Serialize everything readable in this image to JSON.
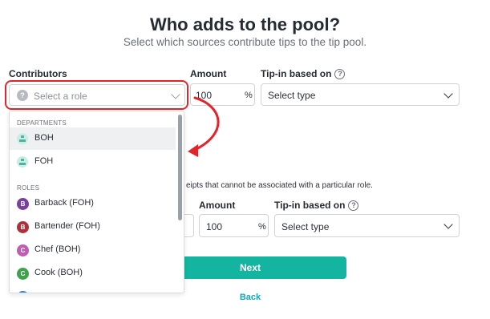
{
  "header": {
    "title": "Who adds to the pool?",
    "subtitle": "Select which sources contribute tips to the tip pool."
  },
  "row1": {
    "contributors_label": "Contributors",
    "amount_label": "Amount",
    "tipin_label": "Tip-in based on",
    "role_placeholder": "Select a role",
    "amount_value": "100",
    "percent_symbol": "%",
    "type_placeholder": "Select type"
  },
  "dropdown": {
    "departments_header": "DEPARTMENTS",
    "departments": [
      {
        "label": "BOH"
      },
      {
        "label": "FOH"
      }
    ],
    "roles_header": "ROLES",
    "roles": [
      {
        "label": "Barback (FOH)",
        "initial": "B",
        "color": "#7b3f9e"
      },
      {
        "label": "Bartender (FOH)",
        "initial": "B",
        "color": "#b0303a"
      },
      {
        "label": "Chef (BOH)",
        "initial": "C",
        "color": "#c25bb3"
      },
      {
        "label": "Cook (BOH)",
        "initial": "C",
        "color": "#3ea34a"
      }
    ]
  },
  "row2": {
    "description_fragment": "eipts that cannot be associated with a particular role.",
    "amount_label": "Amount",
    "tipin_label": "Tip-in based on",
    "amount_value": "100",
    "percent_symbol": "%",
    "type_placeholder": "Select type"
  },
  "actions": {
    "next_label": "Next",
    "back_label": "Back"
  },
  "colors": {
    "accent": "#13b5a0",
    "link": "#13a6b5",
    "annotation": "#e4242b"
  }
}
